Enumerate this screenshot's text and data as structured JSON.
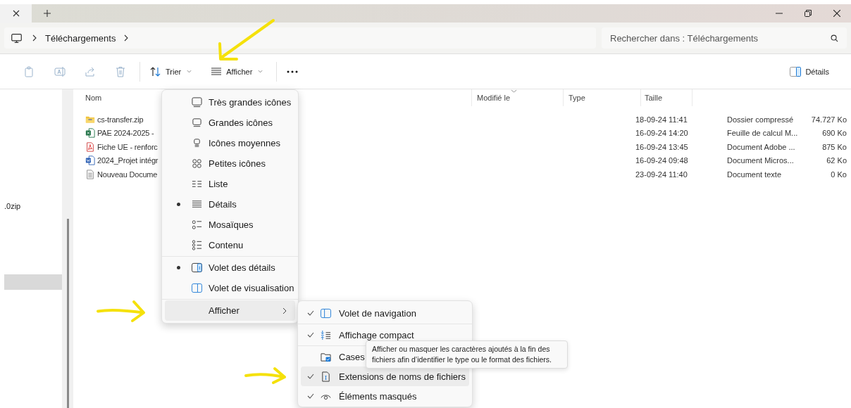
{
  "address_bar": {
    "path": [
      "Téléchargements"
    ]
  },
  "search": {
    "placeholder": "Rechercher dans : Téléchargements"
  },
  "toolbar": {
    "actions": [
      {
        "kind": "copy",
        "disabled": true
      },
      {
        "kind": "rename",
        "disabled": true
      },
      {
        "kind": "share",
        "disabled": true
      },
      {
        "kind": "delete",
        "disabled": true
      },
      {
        "kind": "sort",
        "label": "Trier"
      },
      {
        "kind": "view",
        "label": "Afficher"
      },
      {
        "kind": "more"
      }
    ],
    "details_button": "Détails"
  },
  "navigation": {
    "items": [
      {
        "label": ".0zip",
        "selected": false
      },
      {
        "selected": true
      }
    ]
  },
  "file_list": {
    "columns": [
      {
        "label": "Nom",
        "sorted": false
      },
      {
        "label": "Modifié le",
        "sorted": true
      },
      {
        "label": "Type",
        "sorted": false
      },
      {
        "label": "Taille",
        "sorted": false
      }
    ],
    "rows": [
      {
        "kind": "zip",
        "name": "cs-transfer.zip",
        "modified": "18-09-24 11:41",
        "type": "Dossier compressé",
        "size": "74.727 Ko"
      },
      {
        "kind": "excel",
        "name": "PAE 2024-2025  -",
        "modified": "16-09-24 14:20",
        "type": "Feuille de calcul M...",
        "size": "690 Ko"
      },
      {
        "kind": "pdf",
        "name": "Fiche UE - renforc",
        "modified": "16-09-24 13:45",
        "type": "Document Adobe ...",
        "size": "875 Ko"
      },
      {
        "kind": "word",
        "name": "2024_Projet intégr",
        "modified": "16-09-24 09:48",
        "type": "Document Micros...",
        "size": "62 Ko"
      },
      {
        "kind": "text",
        "name": "Nouveau Docume",
        "modified": "23-09-24 11:40",
        "type": "Document texte",
        "size": "0 Ko"
      }
    ]
  },
  "view_menu": {
    "items": [
      {
        "kind": "item",
        "label": "Très grandes icônes",
        "selected": false
      },
      {
        "kind": "item",
        "label": "Grandes icônes",
        "selected": false
      },
      {
        "kind": "item",
        "label": "Icônes moyennes",
        "selected": false
      },
      {
        "kind": "item",
        "label": "Petites icônes",
        "selected": false
      },
      {
        "kind": "item",
        "label": "Liste",
        "selected": false
      },
      {
        "kind": "item",
        "label": "Détails",
        "selected": true
      },
      {
        "kind": "item",
        "label": "Mosaïques",
        "selected": false
      },
      {
        "kind": "item",
        "label": "Contenu",
        "selected": false
      },
      {
        "kind": "separator"
      },
      {
        "kind": "item",
        "label": "Volet des détails",
        "selected": true
      },
      {
        "kind": "item",
        "label": "Volet de visualisation",
        "selected": false
      },
      {
        "kind": "separator"
      },
      {
        "kind": "submenu",
        "label": "Afficher",
        "highlighted": true
      }
    ]
  },
  "show_submenu": {
    "items": [
      {
        "kind": "item",
        "label": "Volet de navigation",
        "checked": true,
        "highlighted": false
      },
      {
        "kind": "separator"
      },
      {
        "kind": "item",
        "label": "Affichage compact",
        "checked": true,
        "highlighted": false
      },
      {
        "kind": "separator"
      },
      {
        "kind": "item",
        "label": "Cases",
        "checked": false,
        "highlighted": false
      },
      {
        "kind": "item",
        "label": "Extensions de noms de fichiers",
        "checked": true,
        "highlighted": true
      },
      {
        "kind": "item",
        "label": "Éléments masqués",
        "checked": true,
        "highlighted": false
      }
    ]
  },
  "tooltip": {
    "text": "Afficher ou masquer les caractères ajoutés à la fin des\nfichiers afin d’identifier le type ou le format des fichiers."
  },
  "annotations": [
    {
      "kind": "arrow"
    },
    {
      "kind": "arrow"
    },
    {
      "kind": "arrow"
    }
  ]
}
